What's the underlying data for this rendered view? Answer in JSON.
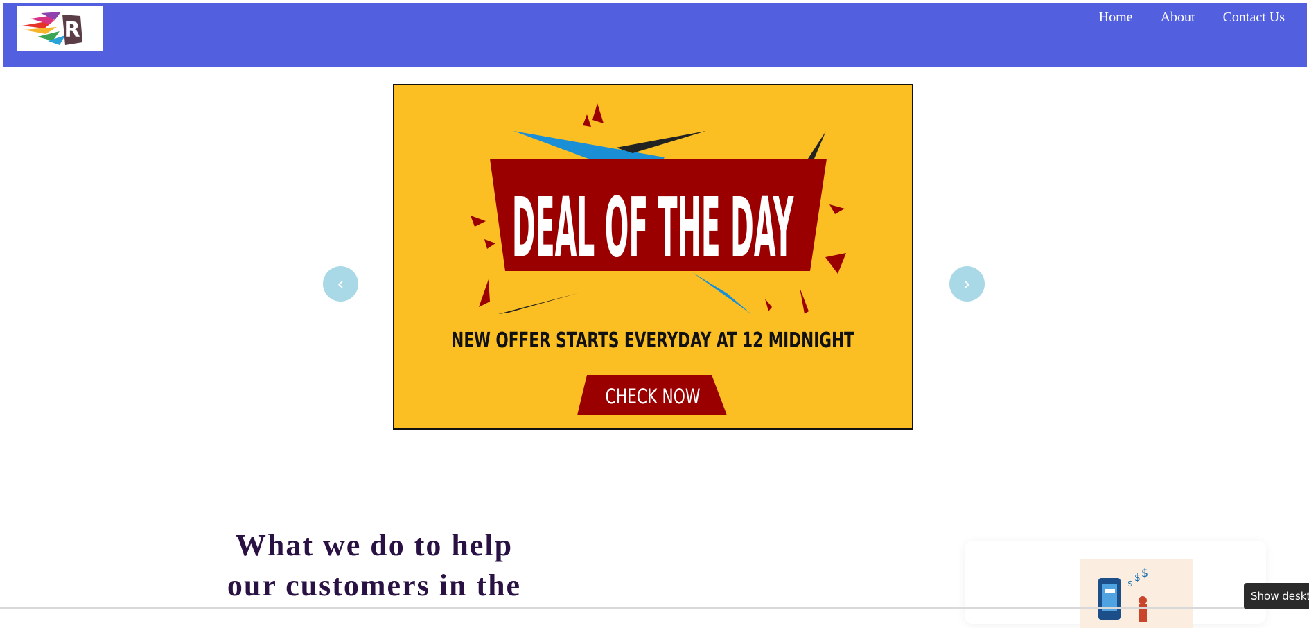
{
  "nav": {
    "logo_letter": "R",
    "links": [
      "Home",
      "About",
      "Contact Us"
    ]
  },
  "carousel": {
    "prev_label": "‹",
    "next_label": "›",
    "banner": {
      "headline": "DEAL OF THE DAY",
      "subtitle": "NEW OFFER STARTS EVERYDAY AT 12 MIDNIGHT",
      "cta": "CHECK NOW"
    }
  },
  "section": {
    "headline_line1": "What we do to help",
    "headline_line2": "our customers in the"
  },
  "toast": {
    "text": "Show desktop"
  },
  "colors": {
    "nav_bg": "#525fdf",
    "banner_bg": "#fbbf24",
    "banner_red": "#9b0000",
    "carousel_btn": "#a9d8e6",
    "headline": "#2a1144"
  }
}
